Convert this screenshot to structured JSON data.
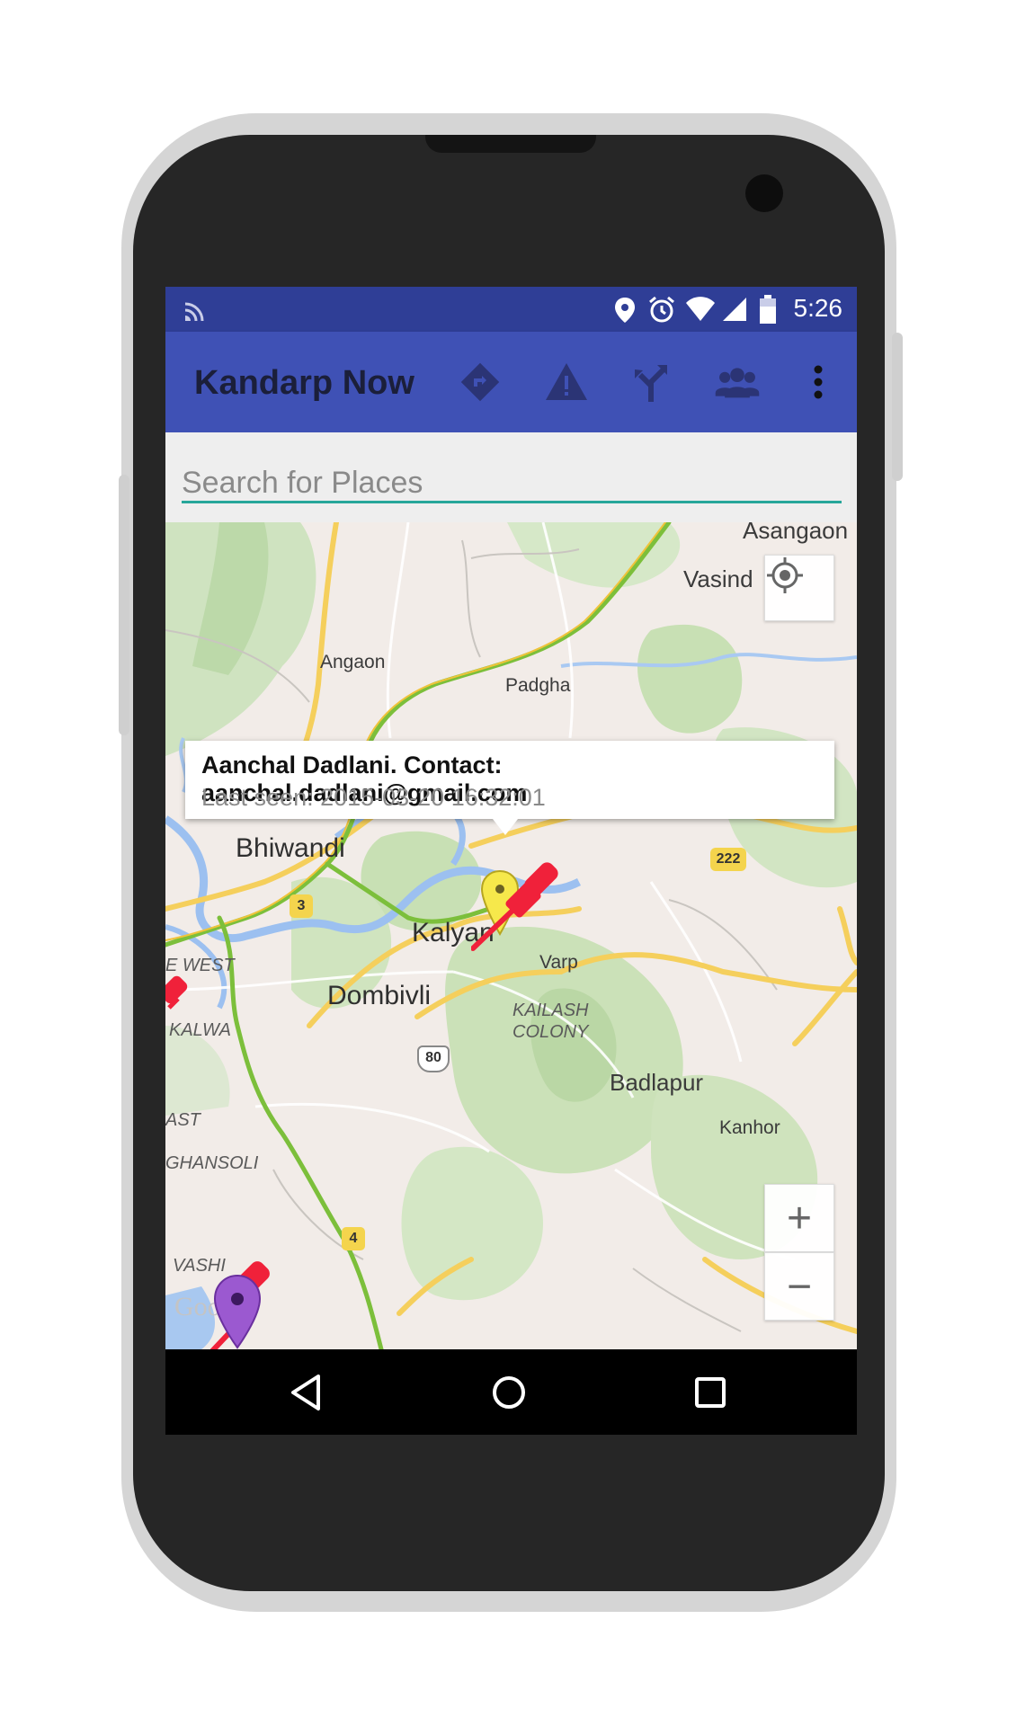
{
  "status_bar": {
    "time": "5:26"
  },
  "app_bar": {
    "title": "Kandarp Now",
    "actions": [
      {
        "name": "directions-icon"
      },
      {
        "name": "warning-icon"
      },
      {
        "name": "fork-route-icon"
      },
      {
        "name": "group-icon"
      },
      {
        "name": "overflow-menu-icon"
      }
    ]
  },
  "search": {
    "placeholder": "Search for Places",
    "value": ""
  },
  "map": {
    "labels": {
      "asangaon": "Asangaon",
      "vasind": "Vasind",
      "angaon": "Angaon",
      "padgha": "Padgha",
      "bhiwandi": "Bhiwandi",
      "kalyan": "Kalyan",
      "varp": "Varp",
      "dombivli": "Dombivli",
      "kailash": "KAILASH",
      "colony": "COLONY",
      "badlapur": "Badlapur",
      "kanhor": "Kanhor",
      "west": "E WEST",
      "kalwa": "KALWA",
      "ast": "AST",
      "ghansoli": "GHANSOLI",
      "vashi": "VASHI",
      "watermark": "Google"
    },
    "shields": {
      "s222": "222",
      "s3": "3",
      "s80": "80",
      "s4": "4"
    },
    "info_window": {
      "title": "Aanchal Dadlani. Contact: aanchal.dadlani@gmail.com",
      "subtitle": "Last seen: 2015-03-20 16:32:01"
    },
    "controls": {
      "zoom_in": "+",
      "zoom_out": "−"
    }
  },
  "colors": {
    "status_bar": "#2f3e96",
    "app_bar": "#3f51b5",
    "accent": "#26a69a",
    "pin": "#f0213a",
    "marker_yellow": "#f6e84b",
    "marker_purple": "#9b59d0"
  }
}
